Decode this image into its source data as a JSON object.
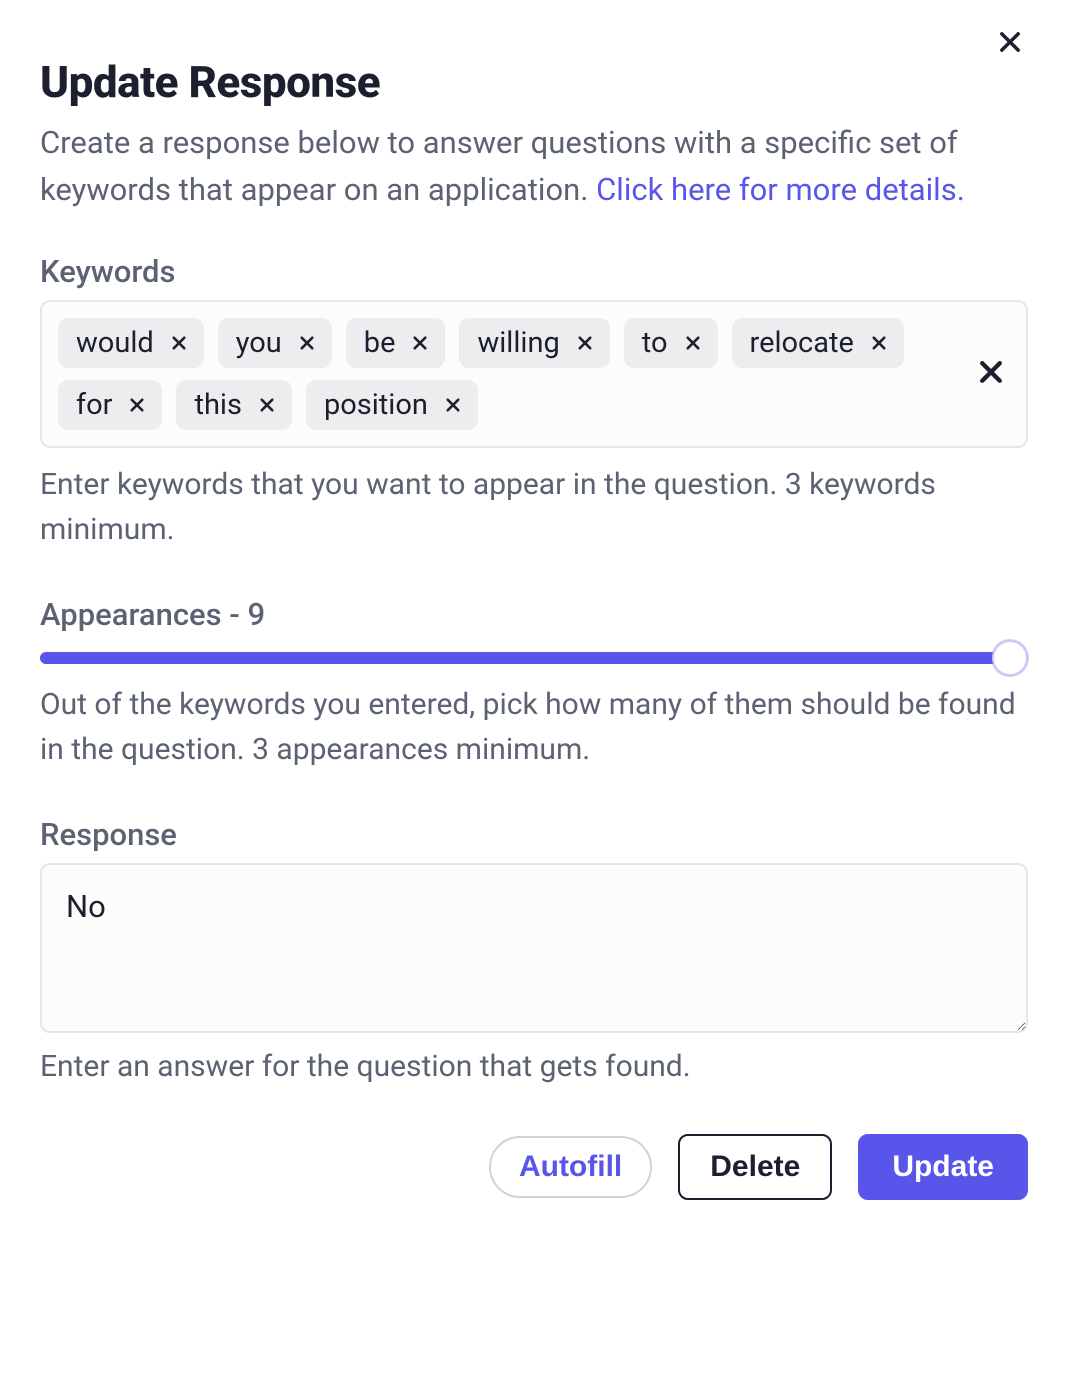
{
  "dialog": {
    "title": "Update Response",
    "description_text": "Create a response below to answer questions with a specific set of keywords that appear on an application. ",
    "description_link": "Click here for more details."
  },
  "keywords": {
    "label": "Keywords",
    "tags": [
      "would",
      "you",
      "be",
      "willing",
      "to",
      "relocate",
      "for",
      "this",
      "position"
    ],
    "helper": "Enter keywords that you want to appear in the question. 3 keywords minimum."
  },
  "appearances": {
    "label_prefix": "Appearances - ",
    "value": 9,
    "min": 3,
    "max": 9,
    "helper": "Out of the keywords you entered, pick how many of them should be found in the question. 3 appearances minimum."
  },
  "response": {
    "label": "Response",
    "value": "No",
    "helper": "Enter an answer for the question that gets found."
  },
  "footer": {
    "autofill": "Autofill",
    "delete": "Delete",
    "update": "Update"
  }
}
